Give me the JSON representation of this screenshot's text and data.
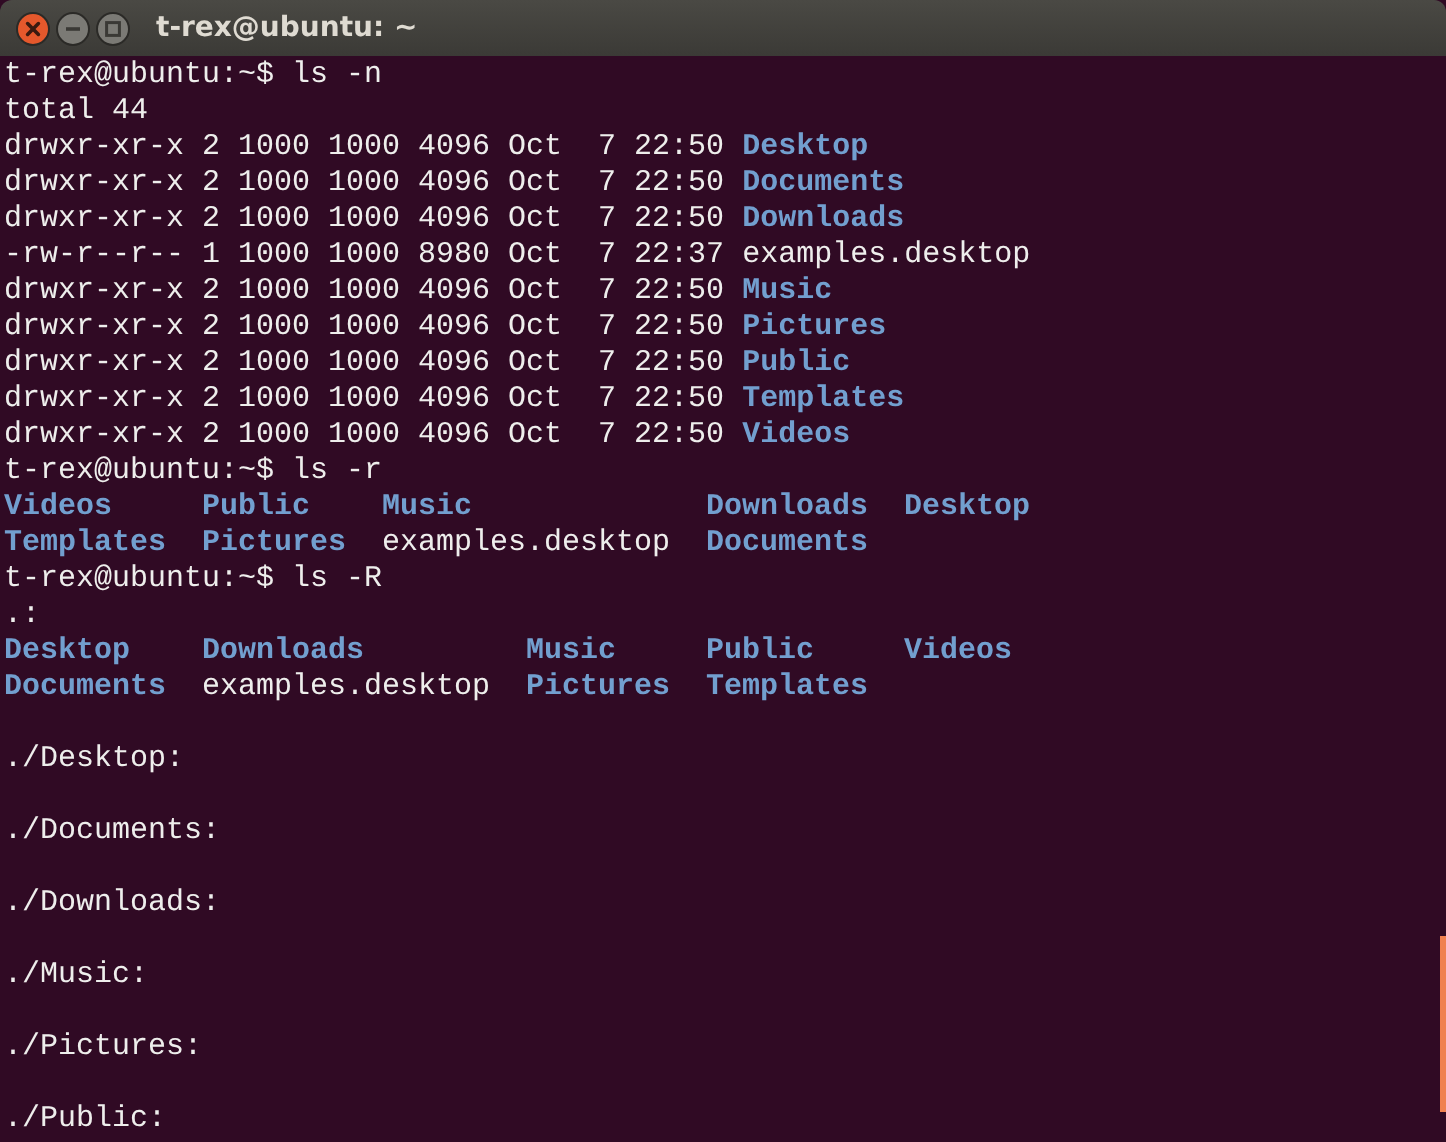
{
  "window": {
    "title": "t-rex@ubuntu: ~"
  },
  "terminal": {
    "blocks": [
      {
        "kind": "text",
        "text": "t-rex@ubuntu:~$ ls -n"
      },
      {
        "kind": "text",
        "text": "total 44"
      },
      {
        "kind": "long",
        "entries": [
          {
            "meta": "drwxr-xr-x 2 1000 1000 4096 Oct  7 22:50",
            "name": "Desktop",
            "kind": "dir"
          },
          {
            "meta": "drwxr-xr-x 2 1000 1000 4096 Oct  7 22:50",
            "name": "Documents",
            "kind": "dir"
          },
          {
            "meta": "drwxr-xr-x 2 1000 1000 4096 Oct  7 22:50",
            "name": "Downloads",
            "kind": "dir"
          },
          {
            "meta": "-rw-r--r-- 1 1000 1000 8980 Oct  7 22:37",
            "name": "examples.desktop",
            "kind": "file"
          },
          {
            "meta": "drwxr-xr-x 2 1000 1000 4096 Oct  7 22:50",
            "name": "Music",
            "kind": "dir"
          },
          {
            "meta": "drwxr-xr-x 2 1000 1000 4096 Oct  7 22:50",
            "name": "Pictures",
            "kind": "dir"
          },
          {
            "meta": "drwxr-xr-x 2 1000 1000 4096 Oct  7 22:50",
            "name": "Public",
            "kind": "dir"
          },
          {
            "meta": "drwxr-xr-x 2 1000 1000 4096 Oct  7 22:50",
            "name": "Templates",
            "kind": "dir"
          },
          {
            "meta": "drwxr-xr-x 2 1000 1000 4096 Oct  7 22:50",
            "name": "Videos",
            "kind": "dir"
          }
        ]
      },
      {
        "kind": "text",
        "text": "t-rex@ubuntu:~$ ls -r"
      },
      {
        "kind": "grid",
        "rows": [
          [
            {
              "name": "Videos",
              "kind": "dir"
            },
            {
              "name": "Public",
              "kind": "dir"
            },
            {
              "name": "Music",
              "kind": "dir"
            },
            {
              "name": "Downloads",
              "kind": "dir"
            },
            {
              "name": "Desktop",
              "kind": "dir"
            }
          ],
          [
            {
              "name": "Templates",
              "kind": "dir"
            },
            {
              "name": "Pictures",
              "kind": "dir"
            },
            {
              "name": "examples.desktop",
              "kind": "file"
            },
            {
              "name": "Documents",
              "kind": "dir"
            }
          ]
        ]
      },
      {
        "kind": "text",
        "text": "t-rex@ubuntu:~$ ls -R"
      },
      {
        "kind": "text",
        "text": ".:"
      },
      {
        "kind": "grid",
        "rows": [
          [
            {
              "name": "Desktop",
              "kind": "dir"
            },
            {
              "name": "Downloads",
              "kind": "dir"
            },
            {
              "name": "Music",
              "kind": "dir"
            },
            {
              "name": "Public",
              "kind": "dir"
            },
            {
              "name": "Videos",
              "kind": "dir"
            }
          ],
          [
            {
              "name": "Documents",
              "kind": "dir"
            },
            {
              "name": "examples.desktop",
              "kind": "file"
            },
            {
              "name": "Pictures",
              "kind": "dir"
            },
            {
              "name": "Templates",
              "kind": "dir"
            }
          ]
        ]
      },
      {
        "kind": "blank"
      },
      {
        "kind": "text",
        "text": "./Desktop:"
      },
      {
        "kind": "blank"
      },
      {
        "kind": "text",
        "text": "./Documents:"
      },
      {
        "kind": "blank"
      },
      {
        "kind": "text",
        "text": "./Downloads:"
      },
      {
        "kind": "blank"
      },
      {
        "kind": "text",
        "text": "./Music:"
      },
      {
        "kind": "blank"
      },
      {
        "kind": "text",
        "text": "./Pictures:"
      },
      {
        "kind": "blank"
      },
      {
        "kind": "text",
        "text": "./Public:"
      }
    ]
  }
}
